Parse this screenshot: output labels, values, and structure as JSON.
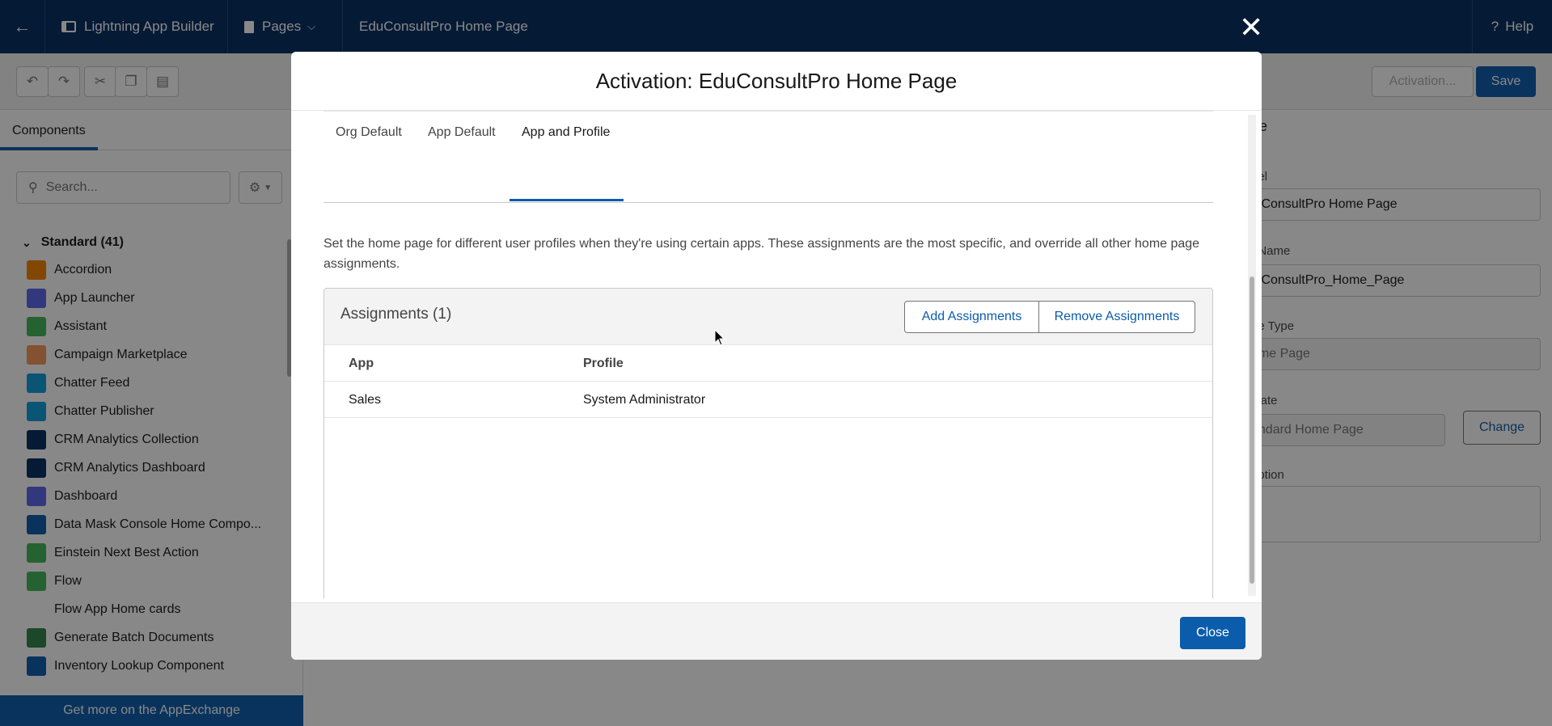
{
  "header": {
    "app_builder": "Lightning App Builder",
    "pages": "Pages",
    "page_name": "EduConsultPro Home Page",
    "help": "Help"
  },
  "toolbar": {
    "activation": "Activation...",
    "save": "Save"
  },
  "left_panel": {
    "tab": "Components",
    "search_placeholder": "Search...",
    "section": "Standard (41)",
    "components": [
      {
        "label": "Accordion",
        "color": "#f38303",
        "icon": "accordion-icon"
      },
      {
        "label": "App Launcher",
        "color": "#5867e8",
        "icon": "app-launcher-icon"
      },
      {
        "label": "Assistant",
        "color": "#41b658",
        "icon": "assistant-icon"
      },
      {
        "label": "Campaign Marketplace",
        "color": "#f49756",
        "icon": "campaign-icon"
      },
      {
        "label": "Chatter Feed",
        "color": "#0d9dda",
        "icon": "chatter-feed-icon"
      },
      {
        "label": "Chatter Publisher",
        "color": "#0d9dda",
        "icon": "chatter-publisher-icon"
      },
      {
        "label": "CRM Analytics Collection",
        "color": "#032d60",
        "icon": "analytics-icon"
      },
      {
        "label": "CRM Analytics Dashboard",
        "color": "#032d60",
        "icon": "analytics-icon"
      },
      {
        "label": "Dashboard",
        "color": "#5867e8",
        "icon": "dashboard-icon"
      },
      {
        "label": "Data Mask Console Home Compo...",
        "color": "#0b5cab",
        "icon": "lightning-icon"
      },
      {
        "label": "Einstein Next Best Action",
        "color": "#41b658",
        "icon": "einstein-icon"
      },
      {
        "label": "Flow",
        "color": "#41b658",
        "icon": "flow-icon"
      },
      {
        "label": "Flow App Home cards",
        "color": "",
        "icon": ""
      },
      {
        "label": "Generate Batch Documents",
        "color": "#2e844a",
        "icon": "document-icon"
      },
      {
        "label": "Inventory Lookup Component",
        "color": "#0b5cab",
        "icon": "box-icon"
      }
    ],
    "appexchange": "Get more on the AppExchange"
  },
  "right_panel": {
    "title": "ge",
    "label_label": "bel",
    "label_value": "luConsultPro Home Page",
    "api_label": "I Name",
    "api_value": "luConsultPro_Home_Page",
    "type_label": "ge Type",
    "type_value": "ome Page",
    "template_label": "plate",
    "template_value": "andard Home Page",
    "change": "Change",
    "desc_label": "ription"
  },
  "modal": {
    "title": "Activation: EduConsultPro Home Page",
    "tabs": [
      "Org Default",
      "App Default",
      "App and Profile"
    ],
    "active_tab": "App and Profile",
    "description": "Set the home page for different user profiles when they're using certain apps. These assignments are the most specific, and override all other home page assignments.",
    "assignments_title": "Assignments (1)",
    "add": "Add Assignments",
    "remove": "Remove Assignments",
    "columns": [
      "App",
      "Profile"
    ],
    "rows": [
      {
        "app": "Sales",
        "profile": "System Administrator"
      }
    ],
    "close": "Close"
  }
}
